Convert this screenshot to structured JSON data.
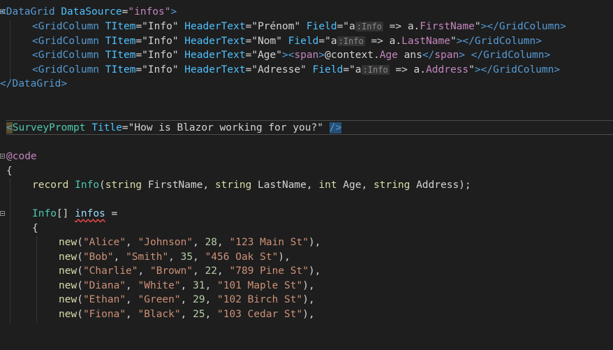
{
  "lines": {
    "l1": {
      "a": "<",
      "b": "DataGrid",
      "c": " ",
      "d": "DataSource",
      "e": "=",
      "f": "\"infos\"",
      "g": ">"
    },
    "l2": {
      "a": "<",
      "b": "GridColumn",
      "c": " ",
      "d": "TItem",
      "e": "=",
      "f": "\"Info\"",
      "g": " ",
      "h": "HeaderText",
      "i": "=",
      "j": "\"Prénom\"",
      "k": " ",
      "l": "Field",
      "m": "=\"a",
      "hint": ":Info",
      "n": " => a.",
      "o": "FirstName",
      "p": "\"",
      "q": "></",
      "r": "GridColumn",
      "s": ">"
    },
    "l3": {
      "a": "<",
      "b": "GridColumn",
      "c": " ",
      "d": "TItem",
      "e": "=",
      "f": "\"Info\"",
      "g": " ",
      "h": "HeaderText",
      "i": "=",
      "j": "\"Nom\"",
      "k": " ",
      "l": "Field",
      "m": "=\"a",
      "hint": ":Info",
      "n": " => a.",
      "o": "LastName",
      "p": "\"",
      "q": "></",
      "r": "GridColumn",
      "s": ">"
    },
    "l4": {
      "a": "<",
      "b": "GridColumn",
      "c": " ",
      "d": "TItem",
      "e": "=",
      "f": "\"Info\"",
      "g": " ",
      "h": "HeaderText",
      "i": "=",
      "j": "\"Age\"",
      "k": "><",
      "l": "span",
      "m": ">",
      "n": "@context.",
      "o": "Age",
      "p": " ans",
      "q": "</",
      "r": "span",
      "s": ">",
      "t": " </",
      "u": "GridColumn",
      "v": ">"
    },
    "l5": {
      "a": "<",
      "b": "GridColumn",
      "c": " ",
      "d": "TItem",
      "e": "=",
      "f": "\"Info\"",
      "g": " ",
      "h": "HeaderText",
      "i": "=",
      "j": "\"Adresse\"",
      "k": " ",
      "l": "Field",
      "m": "=\"a",
      "hint": ":Info",
      "n": " => a.",
      "o": "Address",
      "p": "\"",
      "q": "></",
      "r": "GridColumn",
      "s": ">"
    },
    "l6": {
      "a": "</",
      "b": "DataGrid",
      "c": ">"
    },
    "l9": {
      "a": "<",
      "b": "SurveyPrompt",
      "c": " ",
      "d": "Title",
      "e": "=",
      "f": "\"How is Blazor working for you?\"",
      "g": " ",
      "h": "/>"
    },
    "l11": {
      "a": "@code"
    },
    "l12": {
      "a": "{"
    },
    "l13": {
      "a": "record",
      "b": " ",
      "c": "Info",
      "d": "(",
      "e": "string",
      "f": " FirstName, ",
      "g": "string",
      "h": " LastName, ",
      "i": "int",
      "j": " Age, ",
      "k": "string",
      "l": " Address);"
    },
    "l15": {
      "a": "Info",
      "b": "[] ",
      "c": "infos",
      "d": " ="
    },
    "l16": {
      "a": "{"
    },
    "rows": [
      {
        "n": "new",
        "a": "(",
        "b": "\"Alice\"",
        "c": ", ",
        "d": "\"Johnson\"",
        "e": ", ",
        "f": "28",
        "g": ", ",
        "h": "\"123 Main St\"",
        "i": "),"
      },
      {
        "n": "new",
        "a": "(",
        "b": "\"Bob\"",
        "c": ", ",
        "d": "\"Smith\"",
        "e": ", ",
        "f": "35",
        "g": ", ",
        "h": "\"456 Oak St\"",
        "i": "),"
      },
      {
        "n": "new",
        "a": "(",
        "b": "\"Charlie\"",
        "c": ", ",
        "d": "\"Brown\"",
        "e": ", ",
        "f": "22",
        "g": ", ",
        "h": "\"789 Pine St\"",
        "i": "),"
      },
      {
        "n": "new",
        "a": "(",
        "b": "\"Diana\"",
        "c": ", ",
        "d": "\"White\"",
        "e": ", ",
        "f": "31",
        "g": ", ",
        "h": "\"101 Maple St\"",
        "i": "),"
      },
      {
        "n": "new",
        "a": "(",
        "b": "\"Ethan\"",
        "c": ", ",
        "d": "\"Green\"",
        "e": ", ",
        "f": "29",
        "g": ", ",
        "h": "\"102 Birch St\"",
        "i": "),"
      },
      {
        "n": "new",
        "a": "(",
        "b": "\"Fiona\"",
        "c": ", ",
        "d": "\"Black\"",
        "e": ", ",
        "f": "25",
        "g": ", ",
        "h": "\"103 Cedar St\"",
        "i": "),"
      }
    ]
  }
}
